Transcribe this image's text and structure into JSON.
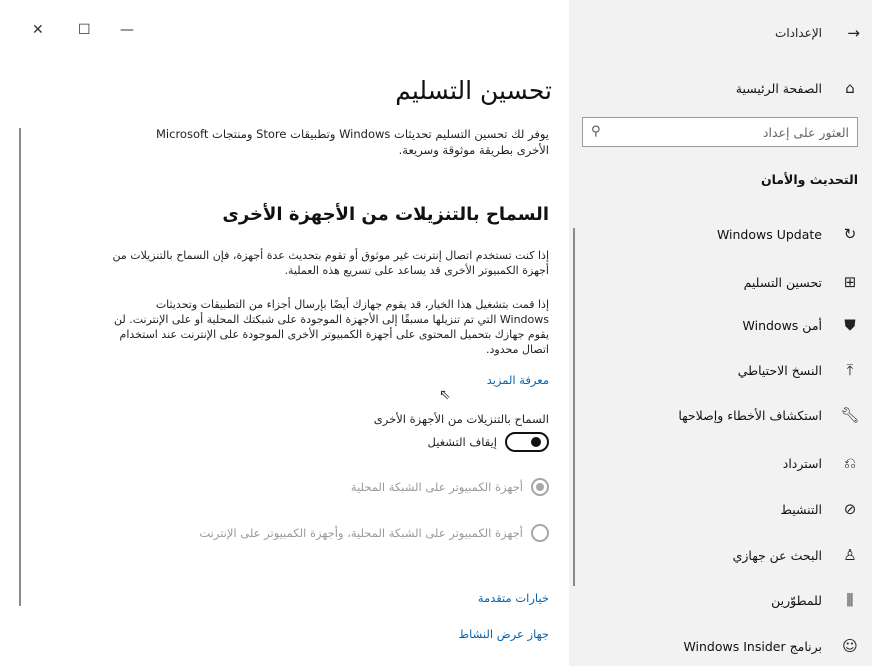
{
  "sidebar": {
    "back_icon": "arrow-right-icon",
    "app_title": "الإعدادات",
    "home": {
      "icon": "home-icon",
      "label": "الصفحة الرئيسية"
    },
    "search": {
      "placeholder": "العثور على إعداد",
      "icon": "search-icon"
    },
    "section_title": "التحديث والأمان",
    "items": [
      {
        "icon": "refresh-icon",
        "label": "Windows Update"
      },
      {
        "icon": "delivery-icon",
        "label": "تحسين التسليم"
      },
      {
        "icon": "shield-icon",
        "label": "أمن Windows"
      },
      {
        "icon": "backup-icon",
        "label": "النسخ الاحتياطي"
      },
      {
        "icon": "wrench-icon",
        "label": "استكشاف الأخطاء وإصلاحها"
      },
      {
        "icon": "recovery-icon",
        "label": "استرداد"
      },
      {
        "icon": "check-circle-icon",
        "label": "التنشيط"
      },
      {
        "icon": "person-location-icon",
        "label": "البحث عن جهازي"
      },
      {
        "icon": "tools-icon",
        "label": "للمطوّرين"
      },
      {
        "icon": "cat-icon",
        "label": "برنامج Windows Insider"
      }
    ]
  },
  "window": {
    "close": "✕",
    "maximize": "☐",
    "minimize": "—"
  },
  "main": {
    "title": "تحسين التسليم",
    "description": "يوفر لك تحسين التسليم تحديثات Windows وتطبيقات Store ومنتجات Microsoft الأخرى بطريقة موثوقة وسريعة.",
    "subtitle": "السماح بالتنزيلات من الأجهزة الأخرى",
    "para1": "إذا كنت تستخدم اتصال إنترنت غير موثوق أو تقوم بتحديث عدة أجهزة، فإن السماح بالتنزيلات من أجهزة الكمبيوتر الأخرى قد يساعد على تسريع هذه العملية.",
    "para2": "إذا قمت بتشغيل هذا الخيار، قد يقوم جهازك أيضًا بإرسال أجزاء من التطبيقات وتحديثات Windows التي تم تنزيلها مسبقًا إلى الأجهزة الموجودة على شبكتك المحلية أو على الإنترنت. لن يقوم جهازك بتحميل المحتوى على أجهزة الكمبيوتر الأخرى الموجودة على الإنترنت عند استخدام اتصال محدود.",
    "learn_more": "معرفة المزيد",
    "toggle_label": "السماح بالتنزيلات من الأجهزة الأخرى",
    "toggle_state": "إيقاف التشغيل",
    "radio_local": "أجهزة الكمبيوتر على الشبكة المحلية",
    "radio_internet": "أجهزة الكمبيوتر على الشبكة المحلية، وأجهزة الكمبيوتر على الإنترنت",
    "advanced_options": "خيارات متقدمة",
    "activity_monitor": "جهاز عرض النشاط"
  }
}
